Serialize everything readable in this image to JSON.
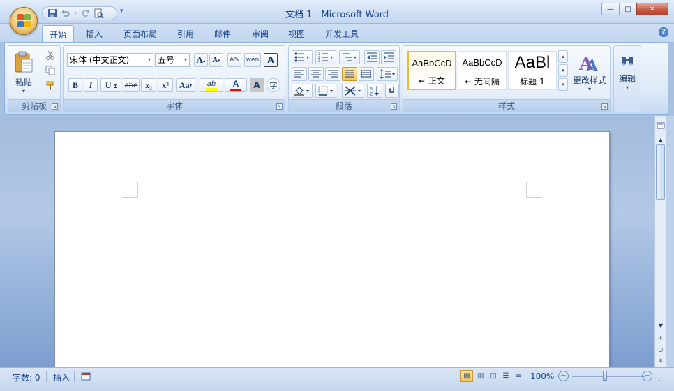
{
  "titlebar": {
    "title": "文档 1 - Microsoft Word",
    "minimize_glyph": "—",
    "maximize_glyph": "□",
    "close_glyph": "✕"
  },
  "qat": {
    "items": [
      "save-icon",
      "undo-icon",
      "redo-icon",
      "print-preview-icon"
    ],
    "more_glyph": "▾"
  },
  "tabs": [
    "开始",
    "插入",
    "页面布局",
    "引用",
    "邮件",
    "审阅",
    "视图",
    "开发工具"
  ],
  "help_glyph": "?",
  "ribbon": {
    "clipboard": {
      "label": "剪贴板",
      "paste_label": "粘贴",
      "paste_arrow": "▾"
    },
    "font": {
      "label": "字体",
      "font_name": "宋体 (中文正文)",
      "font_size": "五号",
      "grow_font": "A",
      "shrink_font": "A",
      "clear_format": "A",
      "phonetic": "wén",
      "char_border": "A",
      "bold": "B",
      "italic": "I",
      "underline": "U",
      "strikethrough": "abe",
      "subscript": "x₂",
      "superscript": "x²",
      "change_case": "Aa",
      "highlight": "ab",
      "font_color": "A",
      "char_shading": "A",
      "enclose_char": "字",
      "highlight_color": "#ffff00",
      "font_color_value": "#ff0000"
    },
    "paragraph": {
      "label": "段落"
    },
    "styles": {
      "label": "样式",
      "items": [
        {
          "sample": "AaBbCcD",
          "name": "↵ 正文"
        },
        {
          "sample": "AaBbCcD",
          "name": "↵ 无间隔"
        },
        {
          "sample": "AaBl",
          "name": "标题 1"
        }
      ],
      "change_styles_label": "更改样式",
      "change_styles_arrow": "▾"
    },
    "editing": {
      "label": "编辑",
      "arrow": "▾"
    }
  },
  "statusbar": {
    "word_count": "字数: 0",
    "mode": "插入",
    "zoom": "100%",
    "zoom_minus": "−",
    "zoom_plus": "+"
  }
}
